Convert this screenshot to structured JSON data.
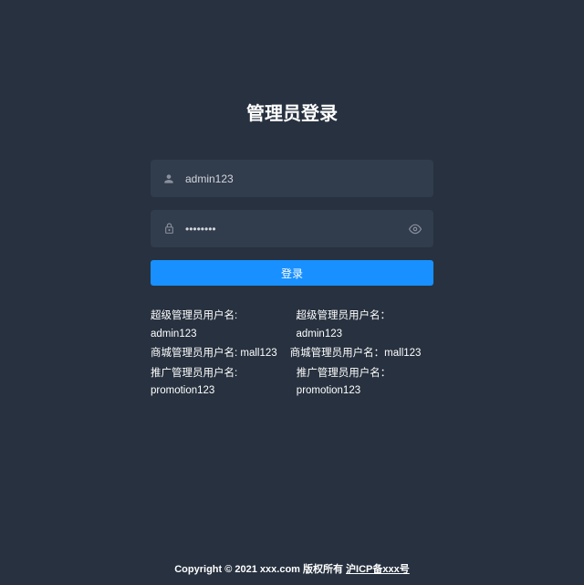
{
  "login": {
    "title": "管理员登录",
    "username_value": "admin123",
    "password_value": "••••••••",
    "button_label": "登录"
  },
  "help": {
    "row1": {
      "left": "超级管理员用户名: admin123",
      "right": "超级管理员用户名：admin123"
    },
    "row2": {
      "left": "商城管理员用户名: mall123",
      "right": "商城管理员用户名：mall123"
    },
    "row3": {
      "left": "推广管理员用户名: promotion123",
      "right": "推广管理员用户名：promotion123"
    }
  },
  "footer": {
    "copyright": "Copyright © 2021 xxx.com 版权所有 ",
    "icp": "沪ICP备xxx号"
  }
}
